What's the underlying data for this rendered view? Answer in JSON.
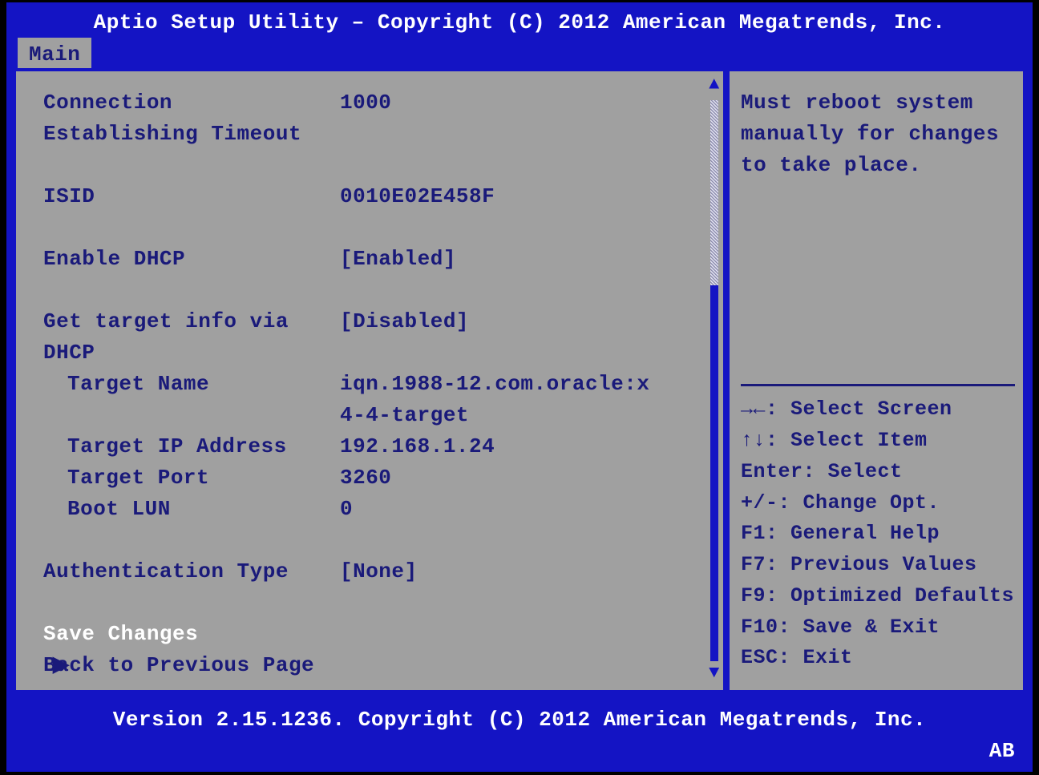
{
  "header": {
    "title": "Aptio Setup Utility – Copyright (C) 2012 American Megatrends, Inc."
  },
  "tabs": {
    "active": "Main"
  },
  "settings": {
    "connection_label": "Connection",
    "connection_value": "1000",
    "establishing_timeout_label": "Establishing Timeout",
    "isid_label": "ISID",
    "isid_value": "0010E02E458F",
    "enable_dhcp_label": "Enable DHCP",
    "enable_dhcp_value": "[Enabled]",
    "get_target_info_label_line1": "Get target info via",
    "get_target_info_label_line2": "DHCP",
    "get_target_info_value": "[Disabled]",
    "target_name_label": "Target Name",
    "target_name_value_line1": "iqn.1988-12.com.oracle:x",
    "target_name_value_line2": "4-4-target",
    "target_ip_label": "Target IP Address",
    "target_ip_value": "192.168.1.24",
    "target_port_label": "Target Port",
    "target_port_value": "3260",
    "boot_lun_label": "Boot LUN",
    "boot_lun_value": "0",
    "auth_type_label": "Authentication Type",
    "auth_type_value": "[None]",
    "save_changes_label": "Save Changes",
    "back_label": "Back to Previous Page"
  },
  "help": {
    "text_line1": "Must reboot system",
    "text_line2": "manually for changes",
    "text_line3": "to take place."
  },
  "legend": {
    "select_screen": "→←: Select Screen",
    "select_item": "↑↓: Select Item",
    "enter": "Enter: Select",
    "change": "+/-: Change Opt.",
    "f1": "F1: General Help",
    "f7": "F7: Previous Values",
    "f9": "F9: Optimized Defaults",
    "f10": "F10: Save & Exit",
    "esc": "ESC: Exit"
  },
  "footer": {
    "version": "Version 2.15.1236. Copyright (C) 2012 American Megatrends, Inc.",
    "brand": "AB"
  }
}
